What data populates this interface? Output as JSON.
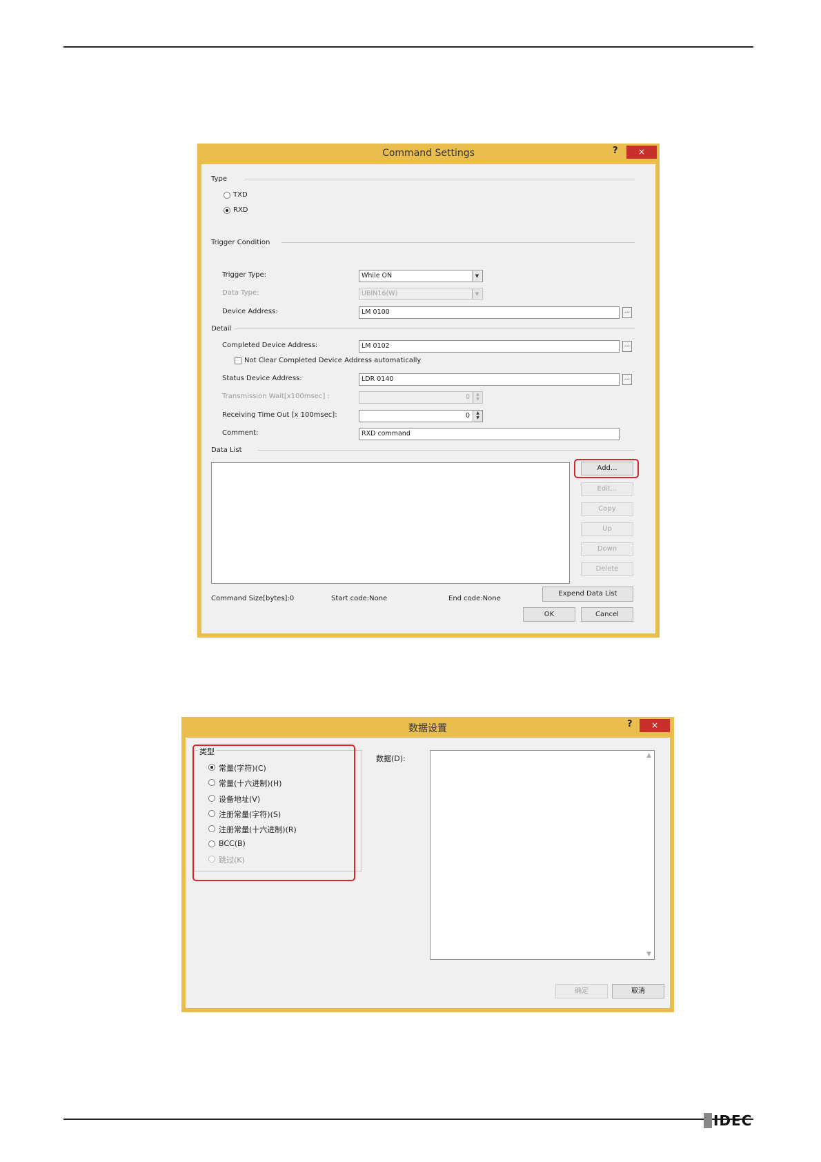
{
  "dialog1": {
    "title": "Command Settings",
    "help": "?",
    "close": "×",
    "type_group": "Type",
    "type_options": [
      "TXD",
      "RXD"
    ],
    "trigger_group": "Trigger Condition",
    "trigger_type_label": "Trigger Type:",
    "trigger_type_value": "While ON",
    "data_type_label": "Data Type:",
    "data_type_value": "UBIN16(W)",
    "device_address_label": "Device Address:",
    "device_address_value": "LM 0100",
    "detail_group": "Detail",
    "completed_label": "Completed Device Address:",
    "completed_value": "LM 0102",
    "not_clear_label": "Not Clear Completed Device Address automatically",
    "status_label": "Status Device Address:",
    "status_value": "LDR 0140",
    "tx_wait_label": "Transmission Wait[x100msec] :",
    "tx_wait_value": "0",
    "rx_timeout_label": "Receiving Time Out [x 100msec]:",
    "rx_timeout_value": "0",
    "comment_label": "Comment:",
    "comment_value": "RXD command",
    "datalist_group": "Data List",
    "buttons": {
      "add": "Add...",
      "edit": "Edit...",
      "copy": "Copy",
      "up": "Up",
      "down": "Down",
      "delete": "Delete"
    },
    "command_size": "Command Size[bytes]:0",
    "start_code": "Start code:None",
    "end_code": "End code:None",
    "expend": "Expend Data List",
    "ok": "OK",
    "cancel": "Cancel",
    "ellipsis": "..."
  },
  "dialog2": {
    "title": "数据设置",
    "help": "?",
    "close": "×",
    "type_group": "类型",
    "options": [
      "常量(字符)(C)",
      "常量(十六进制)(H)",
      "设备地址(V)",
      "注册常量(字符)(S)",
      "注册常量(十六进制)(R)",
      "BCC(B)",
      "跳过(K)"
    ],
    "data_label": "数据(D):",
    "ok": "确定",
    "cancel": "取消"
  },
  "footer": {
    "logo": "IDEC"
  }
}
